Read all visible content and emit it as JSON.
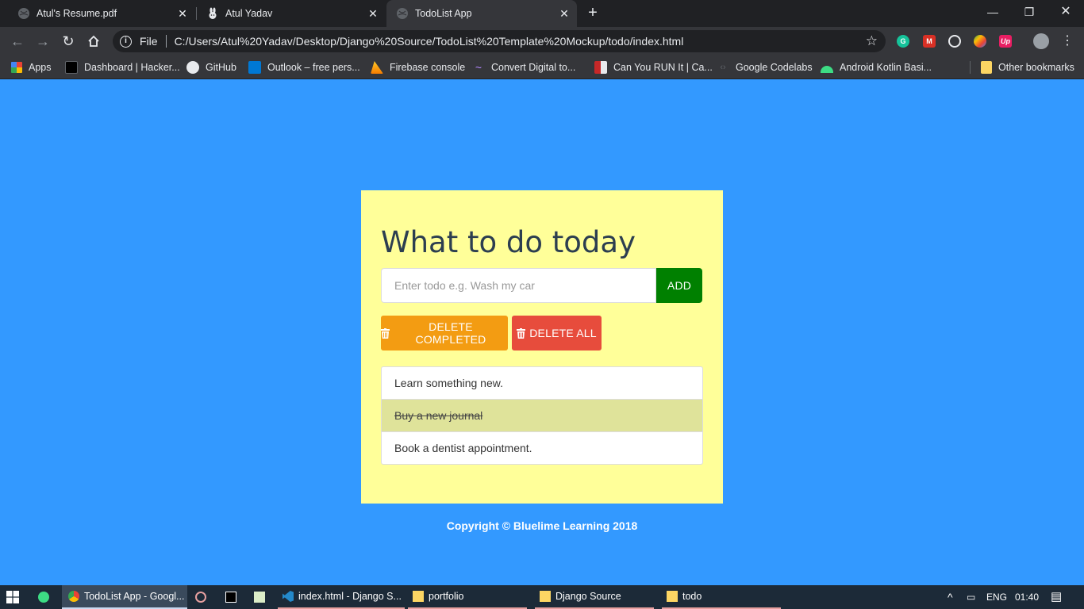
{
  "browser": {
    "tabs": [
      {
        "title": "Atul's Resume.pdf",
        "icon": "globe-icon",
        "active": false
      },
      {
        "title": "Atul Yadav",
        "icon": "rabbit-icon",
        "active": false
      },
      {
        "title": "TodoList App",
        "icon": "globe-icon",
        "active": true
      }
    ],
    "omnibox": {
      "scheme": "File",
      "url": "C:/Users/Atul%20Yadav/Desktop/Django%20Source/TodoList%20Template%20Mockup/todo/index.html"
    },
    "bookmarks": [
      {
        "label": "Apps",
        "icon": "apps-grid-icon"
      },
      {
        "label": "Dashboard | Hacker...",
        "icon": "hackerrank-icon"
      },
      {
        "label": "GitHub",
        "icon": "github-icon"
      },
      {
        "label": "Outlook – free pers...",
        "icon": "outlook-icon"
      },
      {
        "label": "Firebase console",
        "icon": "firebase-icon"
      },
      {
        "label": "Convert Digital to...",
        "icon": "convert-icon"
      },
      {
        "label": "Can You RUN It | Ca...",
        "icon": "canyourunit-icon"
      },
      {
        "label": "Google Codelabs",
        "icon": "codelabs-icon"
      },
      {
        "label": "Android Kotlin Basi...",
        "icon": "android-icon"
      }
    ],
    "other_bookmarks": "Other bookmarks"
  },
  "app": {
    "heading": "What to do today",
    "input_placeholder": "Enter todo e.g. Wash my car",
    "add_label": "ADD",
    "delete_completed_label": "DELETE COMPLETED",
    "delete_all_label": "DELETE ALL",
    "todos": [
      {
        "text": "Learn something new.",
        "done": false
      },
      {
        "text": "Buy a new journal",
        "done": true
      },
      {
        "text": "Book a dentist appointment.",
        "done": false
      }
    ],
    "footer": "Copyright © Bluelime Learning 2018"
  },
  "taskbar": {
    "items": [
      {
        "label": "TodoList App - Googl...",
        "icon": "chrome-icon",
        "active": true
      },
      {
        "label": "index.html - Django S...",
        "icon": "vscode-icon"
      },
      {
        "label": "portfolio",
        "icon": "folder-icon"
      },
      {
        "label": "Django Source",
        "icon": "folder-icon"
      },
      {
        "label": "todo",
        "icon": "folder-icon"
      }
    ],
    "language": "ENG",
    "time": "01:40"
  },
  "colors": {
    "page_bg": "#3399ff",
    "card_bg": "#ffff99",
    "add_button": "#008000",
    "delete_completed": "#f39c12",
    "delete_all": "#e74c3c",
    "done_row": "#dfe39a"
  }
}
